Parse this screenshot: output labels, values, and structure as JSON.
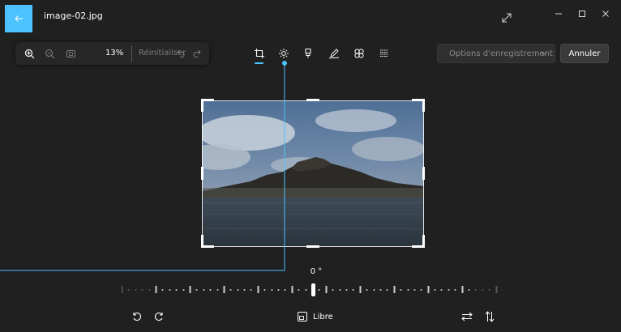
{
  "titlebar": {
    "file_name": "image-02.jpg",
    "back_icon": "arrow-left-icon",
    "accent": "#4cc2ff",
    "expand_icon": "expand-diagonal-icon",
    "window_controls": [
      "minimize-icon",
      "maximize-icon",
      "close-icon"
    ]
  },
  "zoom_bar": {
    "zoom_in_icon": "zoom-in-icon",
    "zoom_out_icon": "zoom-out-icon",
    "fit_icon": "fit-to-window-icon",
    "zoom_percent": "13%",
    "reset_label": "Réinitialiser",
    "undo_icon": "undo-icon",
    "redo_icon": "redo-icon"
  },
  "toolbar": {
    "tools": [
      {
        "name": "crop-icon",
        "active": true
      },
      {
        "name": "brightness-icon",
        "active": false
      },
      {
        "name": "markup-icon",
        "active": false
      },
      {
        "name": "draw-icon",
        "active": false
      },
      {
        "name": "filters-icon",
        "active": false
      },
      {
        "name": "background-icon",
        "active": false
      }
    ]
  },
  "actions": {
    "save_options_label": "Options d'enregistrement",
    "cancel_label": "Annuler"
  },
  "straighten": {
    "angle_label": "0 °"
  },
  "bottom_bar": {
    "rotate_left_icon": "rotate-left-icon",
    "rotate_right_icon": "rotate-right-icon",
    "aspect_icon": "aspect-ratio-icon",
    "aspect_label": "Libre",
    "flip_horizontal_icon": "flip-horizontal-icon",
    "flip_vertical_icon": "flip-vertical-icon"
  }
}
